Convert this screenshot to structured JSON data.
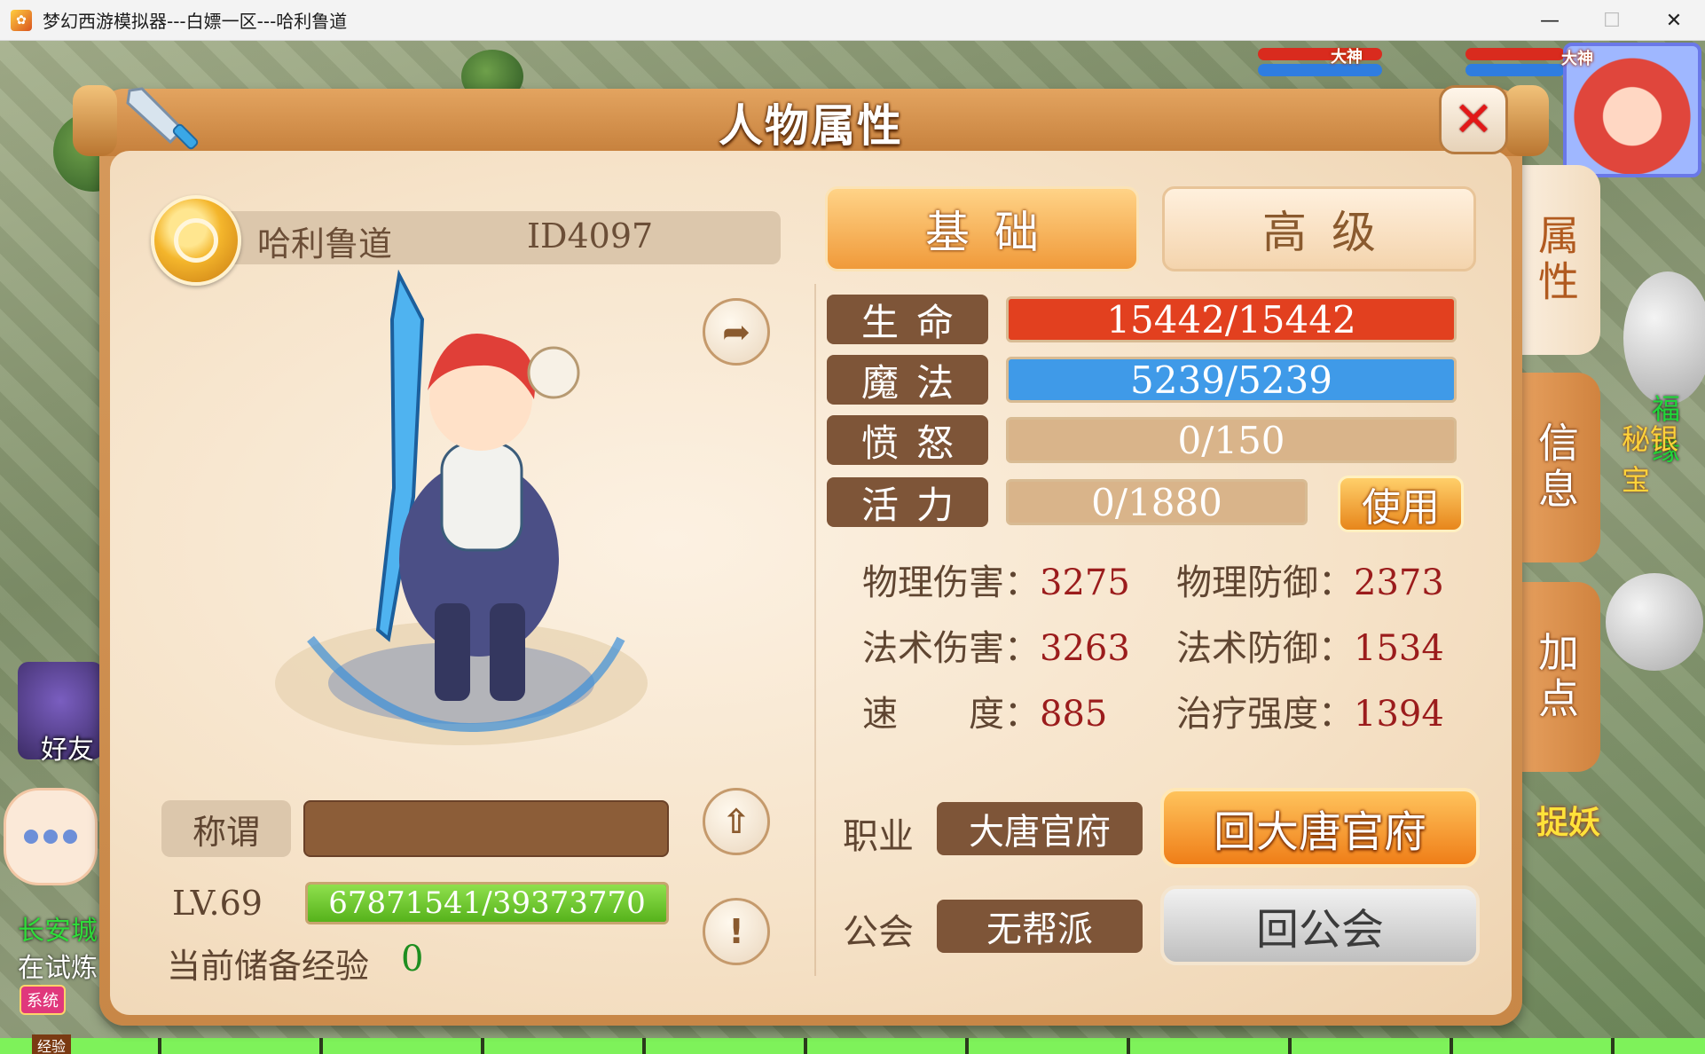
{
  "window": {
    "title": "梦幻西游模拟器---白嫖一区---哈利鲁道",
    "minimize": "—",
    "maximize": "☐",
    "close": "✕"
  },
  "hud": {
    "avatar_tag_1": "大神",
    "avatar_tag_2": "大神",
    "friend_label": "好友",
    "city_label": "长安城",
    "trial_label": "在试炼",
    "system_badge": "系统",
    "exp_strip_label": "经验",
    "right_label_1": "福缘",
    "right_label_2": "秘银宝",
    "right_label_3": "捉妖"
  },
  "panel": {
    "title": "人物属性",
    "close_symbol": "✕",
    "side_tabs": [
      {
        "label": "属性",
        "active": true
      },
      {
        "label": "信息",
        "active": false
      },
      {
        "label": "加点",
        "active": false
      }
    ]
  },
  "character": {
    "name": "哈利鲁道",
    "id": "ID4097",
    "title_label": "称谓",
    "title_value": "",
    "level": "LV.69",
    "exp": "67871541/39373770",
    "exp_fill": 1.0,
    "stored_exp_label": "当前储备经验",
    "stored_exp_value": "0"
  },
  "tabs": {
    "basic": "基础",
    "advanced": "高级"
  },
  "stats": {
    "hp": {
      "label": "生命",
      "value": "15442/15442",
      "fill": 1.0,
      "color": "#e2401f"
    },
    "mp": {
      "label": "魔法",
      "value": "5239/5239",
      "fill": 1.0,
      "color": "#3f9ae8"
    },
    "rage": {
      "label": "愤怒",
      "value": "0/150",
      "fill": 0.0,
      "color": "#d9b48a"
    },
    "vitality": {
      "label": "活力",
      "value": "0/1880",
      "fill": 0.0,
      "color": "#d9b48a"
    },
    "use_button": "使用"
  },
  "attributes": {
    "phys_atk": {
      "label": "物理伤害：",
      "value": "3275"
    },
    "phys_def": {
      "label": "物理防御：",
      "value": "2373"
    },
    "magic_atk": {
      "label": "法术伤害：",
      "value": "3263"
    },
    "magic_def": {
      "label": "法术防御：",
      "value": "1534"
    },
    "speed": {
      "label": "速　　度：",
      "value": "885"
    },
    "heal": {
      "label": "治疗强度：",
      "value": "1394"
    }
  },
  "job": {
    "label": "职业",
    "value": "大唐官府",
    "button": "回大唐官府"
  },
  "guild": {
    "label": "公会",
    "value": "无帮派",
    "button": "回公会"
  },
  "icons": {
    "share": "share-icon",
    "upload": "upload-icon",
    "info": "exclamation-icon",
    "sword": "sword-icon",
    "badge": "sect-badge-icon"
  }
}
